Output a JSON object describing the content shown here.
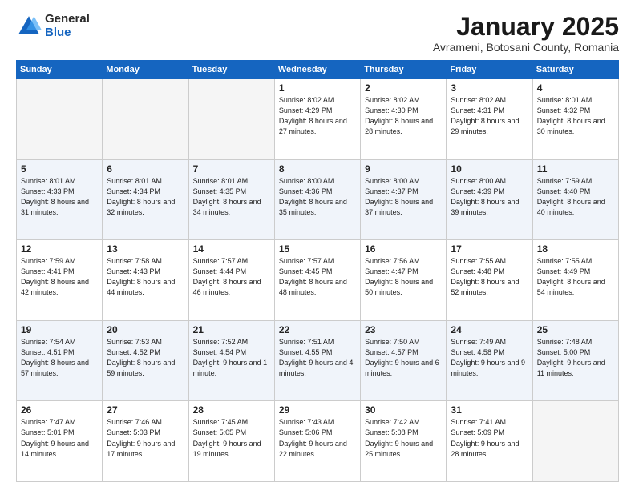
{
  "logo": {
    "general": "General",
    "blue": "Blue"
  },
  "title": {
    "month": "January 2025",
    "location": "Avrameni, Botosani County, Romania"
  },
  "weekdays": [
    "Sunday",
    "Monday",
    "Tuesday",
    "Wednesday",
    "Thursday",
    "Friday",
    "Saturday"
  ],
  "weeks": [
    [
      {
        "day": "",
        "info": ""
      },
      {
        "day": "",
        "info": ""
      },
      {
        "day": "",
        "info": ""
      },
      {
        "day": "1",
        "info": "Sunrise: 8:02 AM\nSunset: 4:29 PM\nDaylight: 8 hours and 27 minutes."
      },
      {
        "day": "2",
        "info": "Sunrise: 8:02 AM\nSunset: 4:30 PM\nDaylight: 8 hours and 28 minutes."
      },
      {
        "day": "3",
        "info": "Sunrise: 8:02 AM\nSunset: 4:31 PM\nDaylight: 8 hours and 29 minutes."
      },
      {
        "day": "4",
        "info": "Sunrise: 8:01 AM\nSunset: 4:32 PM\nDaylight: 8 hours and 30 minutes."
      }
    ],
    [
      {
        "day": "5",
        "info": "Sunrise: 8:01 AM\nSunset: 4:33 PM\nDaylight: 8 hours and 31 minutes."
      },
      {
        "day": "6",
        "info": "Sunrise: 8:01 AM\nSunset: 4:34 PM\nDaylight: 8 hours and 32 minutes."
      },
      {
        "day": "7",
        "info": "Sunrise: 8:01 AM\nSunset: 4:35 PM\nDaylight: 8 hours and 34 minutes."
      },
      {
        "day": "8",
        "info": "Sunrise: 8:00 AM\nSunset: 4:36 PM\nDaylight: 8 hours and 35 minutes."
      },
      {
        "day": "9",
        "info": "Sunrise: 8:00 AM\nSunset: 4:37 PM\nDaylight: 8 hours and 37 minutes."
      },
      {
        "day": "10",
        "info": "Sunrise: 8:00 AM\nSunset: 4:39 PM\nDaylight: 8 hours and 39 minutes."
      },
      {
        "day": "11",
        "info": "Sunrise: 7:59 AM\nSunset: 4:40 PM\nDaylight: 8 hours and 40 minutes."
      }
    ],
    [
      {
        "day": "12",
        "info": "Sunrise: 7:59 AM\nSunset: 4:41 PM\nDaylight: 8 hours and 42 minutes."
      },
      {
        "day": "13",
        "info": "Sunrise: 7:58 AM\nSunset: 4:43 PM\nDaylight: 8 hours and 44 minutes."
      },
      {
        "day": "14",
        "info": "Sunrise: 7:57 AM\nSunset: 4:44 PM\nDaylight: 8 hours and 46 minutes."
      },
      {
        "day": "15",
        "info": "Sunrise: 7:57 AM\nSunset: 4:45 PM\nDaylight: 8 hours and 48 minutes."
      },
      {
        "day": "16",
        "info": "Sunrise: 7:56 AM\nSunset: 4:47 PM\nDaylight: 8 hours and 50 minutes."
      },
      {
        "day": "17",
        "info": "Sunrise: 7:55 AM\nSunset: 4:48 PM\nDaylight: 8 hours and 52 minutes."
      },
      {
        "day": "18",
        "info": "Sunrise: 7:55 AM\nSunset: 4:49 PM\nDaylight: 8 hours and 54 minutes."
      }
    ],
    [
      {
        "day": "19",
        "info": "Sunrise: 7:54 AM\nSunset: 4:51 PM\nDaylight: 8 hours and 57 minutes."
      },
      {
        "day": "20",
        "info": "Sunrise: 7:53 AM\nSunset: 4:52 PM\nDaylight: 8 hours and 59 minutes."
      },
      {
        "day": "21",
        "info": "Sunrise: 7:52 AM\nSunset: 4:54 PM\nDaylight: 9 hours and 1 minute."
      },
      {
        "day": "22",
        "info": "Sunrise: 7:51 AM\nSunset: 4:55 PM\nDaylight: 9 hours and 4 minutes."
      },
      {
        "day": "23",
        "info": "Sunrise: 7:50 AM\nSunset: 4:57 PM\nDaylight: 9 hours and 6 minutes."
      },
      {
        "day": "24",
        "info": "Sunrise: 7:49 AM\nSunset: 4:58 PM\nDaylight: 9 hours and 9 minutes."
      },
      {
        "day": "25",
        "info": "Sunrise: 7:48 AM\nSunset: 5:00 PM\nDaylight: 9 hours and 11 minutes."
      }
    ],
    [
      {
        "day": "26",
        "info": "Sunrise: 7:47 AM\nSunset: 5:01 PM\nDaylight: 9 hours and 14 minutes."
      },
      {
        "day": "27",
        "info": "Sunrise: 7:46 AM\nSunset: 5:03 PM\nDaylight: 9 hours and 17 minutes."
      },
      {
        "day": "28",
        "info": "Sunrise: 7:45 AM\nSunset: 5:05 PM\nDaylight: 9 hours and 19 minutes."
      },
      {
        "day": "29",
        "info": "Sunrise: 7:43 AM\nSunset: 5:06 PM\nDaylight: 9 hours and 22 minutes."
      },
      {
        "day": "30",
        "info": "Sunrise: 7:42 AM\nSunset: 5:08 PM\nDaylight: 9 hours and 25 minutes."
      },
      {
        "day": "31",
        "info": "Sunrise: 7:41 AM\nSunset: 5:09 PM\nDaylight: 9 hours and 28 minutes."
      },
      {
        "day": "",
        "info": ""
      }
    ]
  ]
}
